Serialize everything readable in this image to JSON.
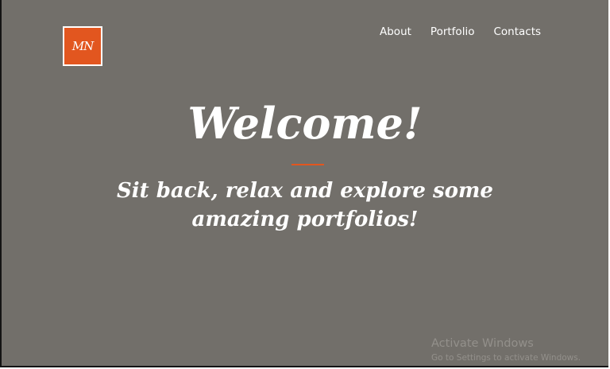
{
  "logo": {
    "text": "MN"
  },
  "nav": {
    "items": [
      {
        "label": "About"
      },
      {
        "label": "Portfolio"
      },
      {
        "label": "Contacts"
      }
    ]
  },
  "hero": {
    "title": "Welcome!",
    "tagline": "Sit back, relax and explore some amazing portfolios!"
  },
  "watermark": {
    "title": "Activate Windows",
    "subtitle": "Go to Settings to activate Windows."
  },
  "colors": {
    "background": "#726f6a",
    "accent": "#e2561f",
    "text": "#ffffff"
  }
}
